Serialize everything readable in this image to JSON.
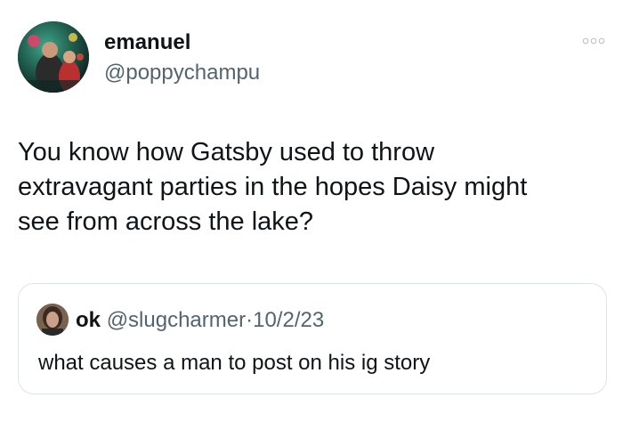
{
  "tweet": {
    "author": {
      "display_name": "emanuel",
      "handle": "@poppychampu"
    },
    "text": "You know how Gatsby used to throw\nextravagant parties in the hopes Daisy might\nsee from across the lake?",
    "menu_icon": "more-horizontal-icon"
  },
  "quote": {
    "author": {
      "display_name": "ok",
      "handle": "@slugcharmer"
    },
    "separator": "·",
    "date": "10/2/23",
    "text": "what causes a man to post on his ig story"
  },
  "colors": {
    "text_primary": "#0f1419",
    "text_secondary": "#536471",
    "border": "#dfe4e8"
  }
}
